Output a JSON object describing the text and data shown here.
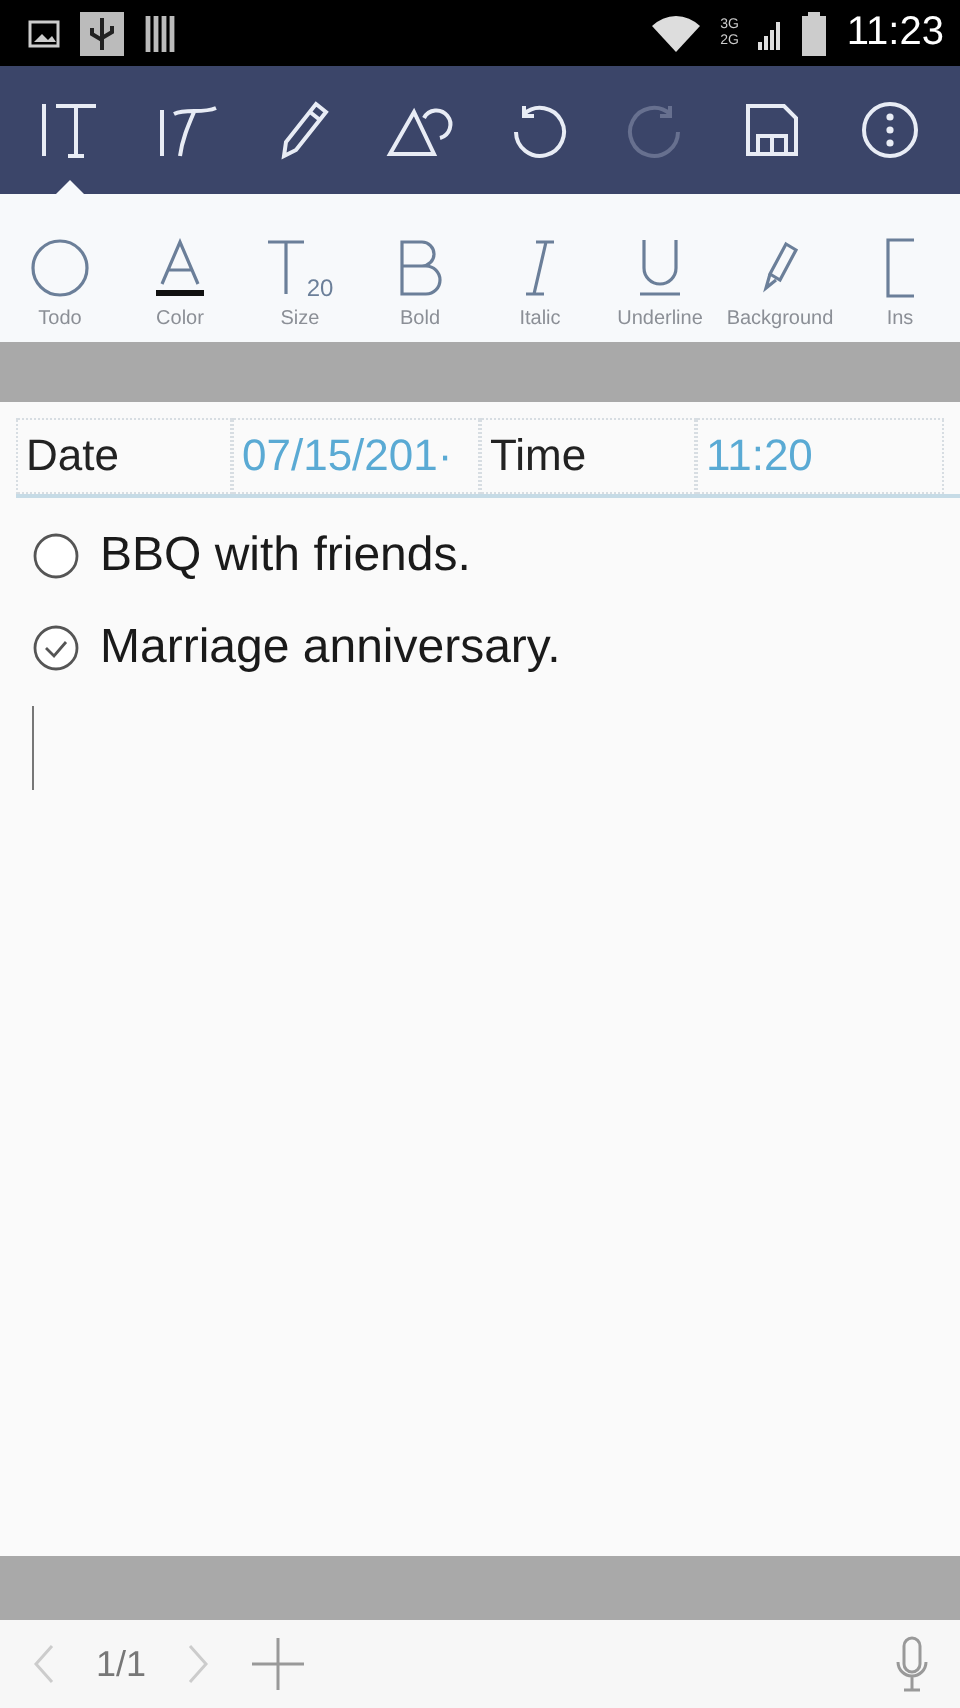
{
  "status_bar": {
    "network_top": "3G",
    "network_bottom": "2G",
    "time": "11:23"
  },
  "toolbar": {
    "tools": [
      {
        "kind": "text",
        "selected": true
      },
      {
        "kind": "handwriting",
        "selected": false
      },
      {
        "kind": "pen",
        "selected": false
      },
      {
        "kind": "shapes",
        "selected": false
      },
      {
        "kind": "undo",
        "selected": false,
        "disabled": false
      },
      {
        "kind": "redo",
        "selected": false,
        "disabled": true
      },
      {
        "kind": "save",
        "selected": false
      },
      {
        "kind": "more",
        "selected": false
      }
    ]
  },
  "format_bar": [
    {
      "kind": "todo",
      "label": "Todo"
    },
    {
      "kind": "color",
      "label": "Color"
    },
    {
      "kind": "size",
      "label": "Size",
      "value": "20"
    },
    {
      "kind": "bold",
      "label": "Bold"
    },
    {
      "kind": "italic",
      "label": "Italic"
    },
    {
      "kind": "underline",
      "label": "Underline"
    },
    {
      "kind": "background",
      "label": "Background"
    },
    {
      "kind": "insert",
      "label": "Ins"
    }
  ],
  "note": {
    "date_label": "Date",
    "date_value": "07/15/201·",
    "time_label": "Time",
    "time_value": "11:20",
    "todos": [
      {
        "text": "BBQ with friends.",
        "checked": false
      },
      {
        "text": "Marriage anniversary.",
        "checked": true
      }
    ]
  },
  "footer": {
    "page": "1/1"
  }
}
